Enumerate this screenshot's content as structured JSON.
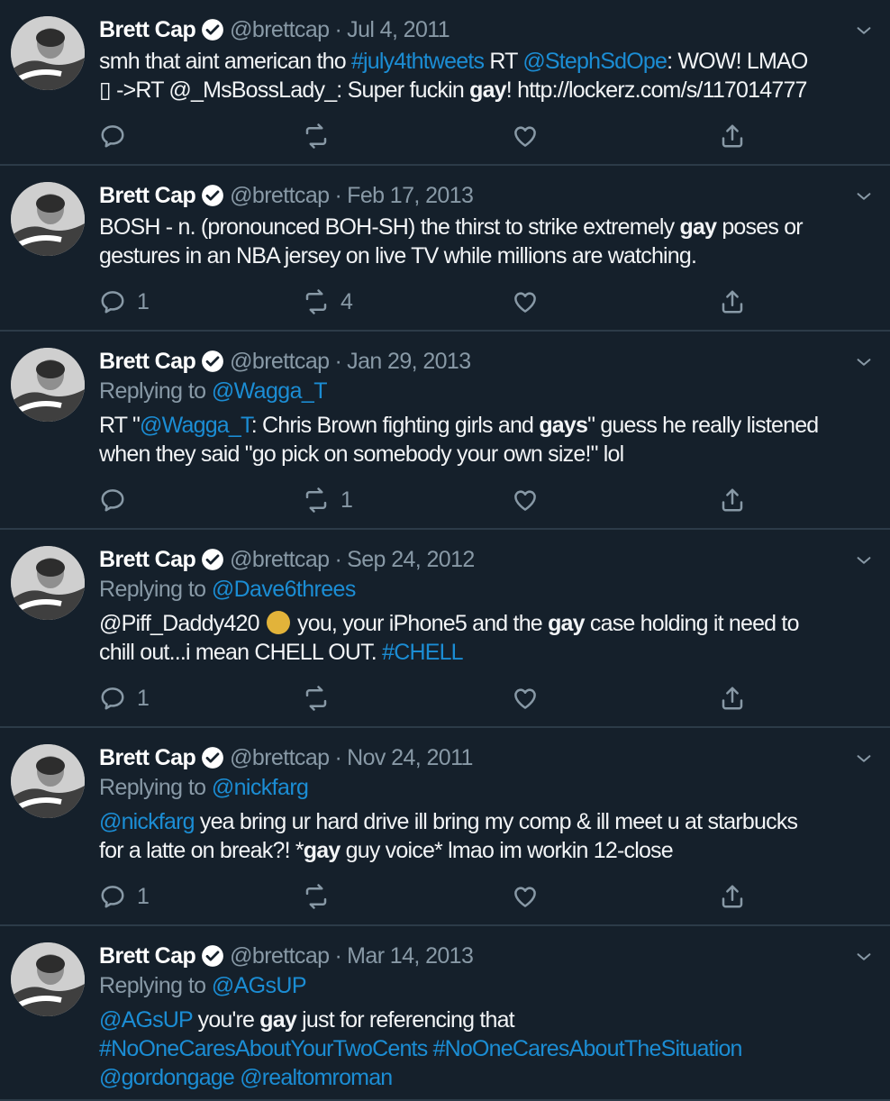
{
  "tweets": [
    {
      "name": "Brett Cap",
      "handle": "@brettcap",
      "date": "Jul 4, 2011",
      "sep": "·",
      "replying_prefix": "",
      "replying_to": "",
      "lines": [
        [
          {
            "t": "smh that aint american tho "
          },
          {
            "t": "#july4thtweets",
            "c": "link"
          },
          {
            "t": " RT "
          },
          {
            "t": "@StephSdOpe",
            "c": "link"
          },
          {
            "t": ": WOW! LMAO"
          }
        ],
        [
          {
            "t": "▯ ->RT @_MsBossLady_: Super fuckin "
          },
          {
            "t": "gay",
            "c": "b"
          },
          {
            "t": "! http://lockerz.com/s/117014777"
          }
        ]
      ],
      "reply_count": "",
      "retweet_count": "",
      "like_count": ""
    },
    {
      "name": "Brett Cap",
      "handle": "@brettcap",
      "date": "Feb 17, 2013",
      "sep": "·",
      "replying_prefix": "",
      "replying_to": "",
      "lines": [
        [
          {
            "t": "BOSH - n. (pronounced BOH-SH) the thirst to strike extremely "
          },
          {
            "t": "gay",
            "c": "b"
          },
          {
            "t": " poses or"
          }
        ],
        [
          {
            "t": "gestures in an NBA jersey on live TV while millions are watching."
          }
        ]
      ],
      "reply_count": "1",
      "retweet_count": "4",
      "like_count": ""
    },
    {
      "name": "Brett Cap",
      "handle": "@brettcap",
      "date": "Jan 29, 2013",
      "sep": "·",
      "replying_prefix": "Replying to ",
      "replying_to": "@Wagga_T",
      "lines": [
        [
          {
            "t": "RT \""
          },
          {
            "t": "@Wagga_T",
            "c": "link"
          },
          {
            "t": ": Chris Brown fighting girls and "
          },
          {
            "t": "gays",
            "c": "b"
          },
          {
            "t": "\" guess he really listened"
          }
        ],
        [
          {
            "t": "when they said \"go pick on somebody your own size!\" lol"
          }
        ]
      ],
      "reply_count": "",
      "retweet_count": "1",
      "like_count": ""
    },
    {
      "name": "Brett Cap",
      "handle": "@brettcap",
      "date": "Sep 24, 2012",
      "sep": "·",
      "replying_prefix": "Replying to ",
      "replying_to": "@Dave6threes",
      "lines": [
        [
          {
            "t": "@Piff_Daddy420 "
          },
          {
            "t": "",
            "c": "emoji"
          },
          {
            "t": " you, your iPhone5 and the "
          },
          {
            "t": "gay",
            "c": "b"
          },
          {
            "t": " case holding it need to"
          }
        ],
        [
          {
            "t": "chill out...i mean CHELL OUT. "
          },
          {
            "t": "#CHELL",
            "c": "link"
          }
        ]
      ],
      "reply_count": "1",
      "retweet_count": "",
      "like_count": ""
    },
    {
      "name": "Brett Cap",
      "handle": "@brettcap",
      "date": "Nov 24, 2011",
      "sep": "·",
      "replying_prefix": "Replying to ",
      "replying_to": "@nickfarg",
      "lines": [
        [
          {
            "t": "@nickfarg",
            "c": "link"
          },
          {
            "t": " yea bring ur hard drive ill bring my comp & ill meet u at starbucks"
          }
        ],
        [
          {
            "t": "for a latte on break?! *"
          },
          {
            "t": "gay",
            "c": "b"
          },
          {
            "t": " guy voice* lmao im workin 12-close"
          }
        ]
      ],
      "reply_count": "1",
      "retweet_count": "",
      "like_count": ""
    },
    {
      "name": "Brett Cap",
      "handle": "@brettcap",
      "date": "Mar 14, 2013",
      "sep": "·",
      "replying_prefix": "Replying to ",
      "replying_to": "@AGsUP",
      "lines": [
        [
          {
            "t": "@AGsUP",
            "c": "link"
          },
          {
            "t": " you're "
          },
          {
            "t": "gay",
            "c": "b"
          },
          {
            "t": " just for referencing that"
          }
        ],
        [
          {
            "t": "#NoOneCaresAboutYourTwoCents",
            "c": "link"
          },
          {
            "t": " "
          },
          {
            "t": "#NoOneCaresAboutTheSituation",
            "c": "link"
          }
        ],
        [
          {
            "t": "@gordongage",
            "c": "link"
          },
          {
            "t": " "
          },
          {
            "t": "@realtomroman",
            "c": "link"
          }
        ]
      ],
      "reply_count": "",
      "retweet_count": "",
      "like_count": ""
    }
  ],
  "icons": {
    "verified": "verified-badge-icon",
    "caret": "chevron-down-icon",
    "reply": "reply-icon",
    "retweet": "retweet-icon",
    "like": "heart-icon",
    "share": "share-icon"
  },
  "colors": {
    "background": "#15202b",
    "divider": "#2c3b48",
    "link": "#1da1f2",
    "muted": "#8899a6"
  }
}
